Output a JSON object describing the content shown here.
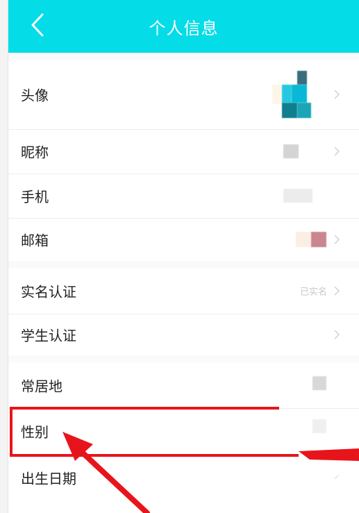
{
  "header": {
    "title": "个人信息",
    "back_icon": "chevron-left-icon",
    "background_color": "#04dce8"
  },
  "rows": [
    {
      "id": "avatar",
      "label": "头像"
    },
    {
      "id": "nickname",
      "label": "昵称"
    },
    {
      "id": "phone",
      "label": "手机"
    },
    {
      "id": "email",
      "label": "邮箱"
    },
    {
      "id": "real-name",
      "label": "实名认证",
      "status": "已实名"
    },
    {
      "id": "student",
      "label": "学生认证"
    },
    {
      "id": "residence",
      "label": "常居地"
    },
    {
      "id": "gender",
      "label": "性别"
    },
    {
      "id": "birthday",
      "label": "出生日期"
    }
  ],
  "annotation": {
    "highlight_color": "#e8141b",
    "highlighted_row": "性别"
  }
}
